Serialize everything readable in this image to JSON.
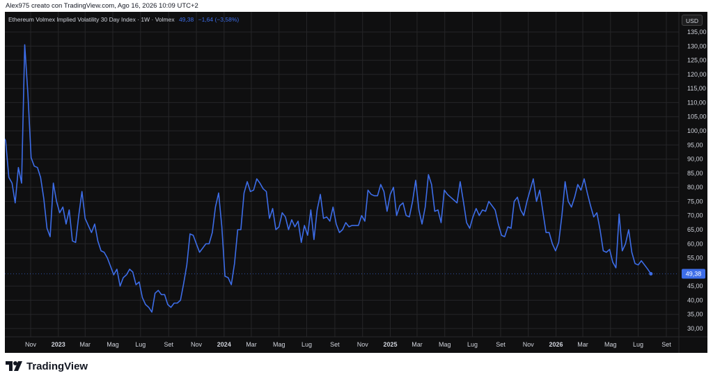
{
  "caption": "Alex975 creato con TradingView.com, Ago 16, 2026 10:09 UTC+2",
  "legend": {
    "title": "Ethereum Volmex Implied Volatility 30 Day Index · 1W · Volmex",
    "value": "49,38",
    "change": "−1,64 (−3,58%)"
  },
  "currency": "USD",
  "last_value_label": "49,38",
  "brand": "TradingView",
  "colors": {
    "line": "#3d6de8",
    "background": "#0f0f10",
    "grid": "#262628",
    "axis_text": "#d1d4dc"
  },
  "chart_data": {
    "type": "line",
    "title": "",
    "xlabel": "",
    "ylabel": "",
    "ylim": [
      25,
      140
    ],
    "grid": true,
    "y_ticks": [
      30,
      35,
      40,
      45,
      55,
      60,
      65,
      70,
      75,
      80,
      85,
      90,
      95,
      100,
      105,
      110,
      115,
      120,
      125,
      130,
      135
    ],
    "y_tick_labels": [
      "30,00",
      "35,00",
      "40,00",
      "45,00",
      "55,00",
      "60,00",
      "65,00",
      "70,00",
      "75,00",
      "80,00",
      "85,00",
      "90,00",
      "95,00",
      "100,00",
      "105,00",
      "110,00",
      "115,00",
      "120,00",
      "125,00",
      "130,00",
      "135,00"
    ],
    "x_ticks": [
      {
        "date": "2022-11-01",
        "label": "Nov"
      },
      {
        "date": "2023-01-01",
        "label": "2023"
      },
      {
        "date": "2023-03-01",
        "label": "Mar"
      },
      {
        "date": "2023-05-01",
        "label": "Mag"
      },
      {
        "date": "2023-07-01",
        "label": "Lug"
      },
      {
        "date": "2023-09-01",
        "label": "Set"
      },
      {
        "date": "2023-11-01",
        "label": "Nov"
      },
      {
        "date": "2024-01-01",
        "label": "2024"
      },
      {
        "date": "2024-03-01",
        "label": "Mar"
      },
      {
        "date": "2024-05-01",
        "label": "Mag"
      },
      {
        "date": "2024-07-01",
        "label": "Lug"
      },
      {
        "date": "2024-09-01",
        "label": "Set"
      },
      {
        "date": "2024-11-01",
        "label": "Nov"
      },
      {
        "date": "2025-01-01",
        "label": "2025"
      },
      {
        "date": "2025-03-01",
        "label": "Mar"
      },
      {
        "date": "2025-05-01",
        "label": "Mag"
      },
      {
        "date": "2025-07-01",
        "label": "Lug"
      },
      {
        "date": "2025-09-01",
        "label": "Set"
      },
      {
        "date": "2025-11-01",
        "label": "Nov"
      },
      {
        "date": "2026-01-01",
        "label": "2026"
      },
      {
        "date": "2026-03-01",
        "label": "Mar"
      },
      {
        "date": "2026-05-01",
        "label": "Mag"
      },
      {
        "date": "2026-07-01",
        "label": "Lug"
      },
      {
        "date": "2026-09-01",
        "label": "Set"
      }
    ],
    "series": [
      {
        "x_start": "2022-08-31",
        "x_step_days": 7,
        "values": [
          98.5,
          96.5,
          83.5,
          81.5,
          74.5,
          87,
          81.5,
          130.5,
          113,
          90.5,
          87.5,
          87,
          83.5,
          76,
          65.5,
          62.5,
          81.5,
          75,
          71,
          73,
          67,
          72,
          61,
          60.5,
          70,
          78.5,
          69,
          66.5,
          64,
          67,
          61,
          57.5,
          57,
          55,
          52,
          49,
          51,
          45,
          48,
          49,
          51,
          50,
          45.5,
          46.5,
          41,
          38.5,
          37.5,
          35.8,
          42.5,
          43.5,
          42,
          42,
          38.5,
          37.5,
          39,
          39,
          40,
          46,
          52.5,
          63.5,
          63,
          60,
          57,
          58.5,
          60,
          60,
          64,
          73,
          78,
          66,
          48.5,
          48,
          45.5,
          53,
          65,
          65,
          78,
          82,
          78.5,
          79,
          83,
          81.5,
          79.5,
          78.5,
          69,
          72.5,
          65,
          66,
          71,
          69.5,
          65,
          68.5,
          66,
          68,
          60.5,
          66.5,
          63,
          72,
          61.5,
          72,
          77.5,
          69,
          69.5,
          68,
          73,
          67,
          64,
          65,
          67.5,
          66,
          66.5,
          66.5,
          66.5,
          70,
          68,
          79,
          77.5,
          77,
          77,
          81,
          78.5,
          71.5,
          77.5,
          80,
          70,
          73.5,
          74.5,
          70,
          69.5,
          75,
          82.5,
          72,
          67,
          73,
          84.5,
          81,
          71.5,
          72,
          67.5,
          79,
          77.5,
          76.5,
          75.5,
          74.5,
          82,
          75,
          67.5,
          65.5,
          69.5,
          72.5,
          70,
          72,
          71.5,
          75,
          73.5,
          72,
          67,
          63,
          62.5,
          66,
          65.5,
          75,
          76.5,
          72,
          70,
          75,
          79,
          83,
          75,
          79,
          71.5,
          64,
          64,
          60,
          57.5,
          60.5,
          70,
          82,
          75,
          73,
          76.5,
          81,
          79,
          83,
          78,
          73.5,
          69.5,
          71,
          65,
          57.5,
          57,
          58,
          53.5,
          51.5,
          70.5,
          57.5,
          60,
          65,
          57,
          53,
          52.5,
          54,
          52.5,
          51,
          49.38
        ]
      }
    ]
  }
}
